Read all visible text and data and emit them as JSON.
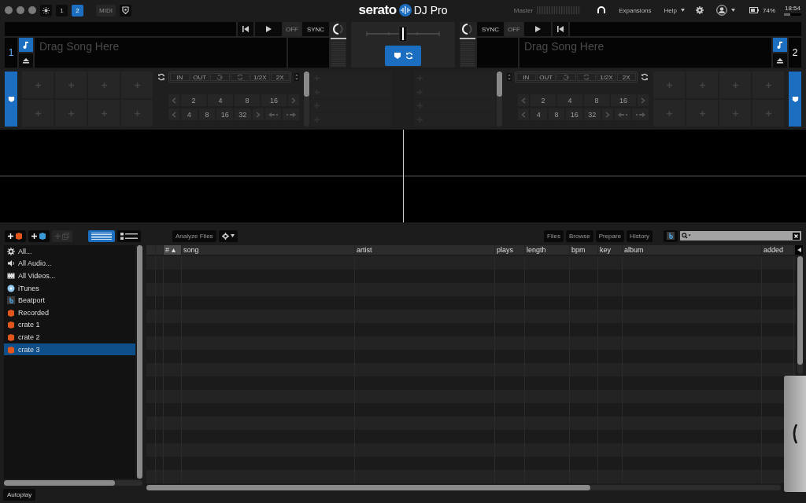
{
  "top_bar": {
    "deck_count_buttons": [
      {
        "label": "1",
        "selected": false
      },
      {
        "label": "2",
        "selected": true
      }
    ],
    "midi_label": "MIDI",
    "logo_text": "serato",
    "product": "DJ Pro",
    "master_label": "Master",
    "expansions": "Expansions",
    "help": "Help",
    "battery": "74%",
    "time": "18:54"
  },
  "decks": [
    {
      "number": "1",
      "placeholder": "Drag Song Here",
      "off_label": "OFF",
      "sync_label": "SYNC"
    },
    {
      "number": "2",
      "placeholder": "Drag Song Here",
      "off_label": "OFF",
      "sync_label": "SYNC"
    }
  ],
  "pad_panels": [
    {
      "loop_labels": [
        "IN",
        "OUT",
        "1/2X",
        "2X"
      ],
      "auto_loop_sizes": [
        "2",
        "4",
        "8",
        "16"
      ],
      "beat_jump_sizes": [
        "4",
        "8",
        "16",
        "32"
      ]
    },
    {
      "loop_labels": [
        "IN",
        "OUT",
        "1/2X",
        "2X"
      ],
      "auto_loop_sizes": [
        "2",
        "4",
        "8",
        "16"
      ],
      "beat_jump_sizes": [
        "4",
        "8",
        "16",
        "32"
      ]
    }
  ],
  "library": {
    "view_modes": [
      {
        "kind": "grid",
        "selected": true
      },
      {
        "kind": "list",
        "selected": false
      }
    ],
    "analyze_button": "Analyze Files",
    "panel_tabs": [
      "Files",
      "Browse",
      "Prepare",
      "History"
    ]
  },
  "sidebar": {
    "items": [
      {
        "label": "All...",
        "kind": "all",
        "selected": false
      },
      {
        "label": "All Audio...",
        "kind": "audio",
        "selected": false
      },
      {
        "label": "All Videos...",
        "kind": "video",
        "selected": false
      },
      {
        "label": "iTunes",
        "kind": "itunes",
        "selected": false
      },
      {
        "label": "Beatport",
        "kind": "beatport",
        "selected": false
      },
      {
        "label": "Recorded",
        "kind": "crate",
        "selected": false
      },
      {
        "label": "crate 1",
        "kind": "crate",
        "selected": false
      },
      {
        "label": "crate 2",
        "kind": "crate",
        "selected": false
      },
      {
        "label": "crate 3",
        "kind": "crate",
        "selected": true
      }
    ]
  },
  "table": {
    "columns": [
      {
        "label": "#",
        "sorted": true
      },
      {
        "label": "song",
        "sorted": false
      },
      {
        "label": "artist",
        "sorted": false
      },
      {
        "label": "plays",
        "sorted": false
      },
      {
        "label": "length",
        "sorted": false
      },
      {
        "label": "bpm",
        "sorted": false
      },
      {
        "label": "key",
        "sorted": false
      },
      {
        "label": "album",
        "sorted": false
      },
      {
        "label": "added",
        "sorted": false
      }
    ]
  },
  "status_bar": {
    "autoplay": "Autoplay"
  }
}
